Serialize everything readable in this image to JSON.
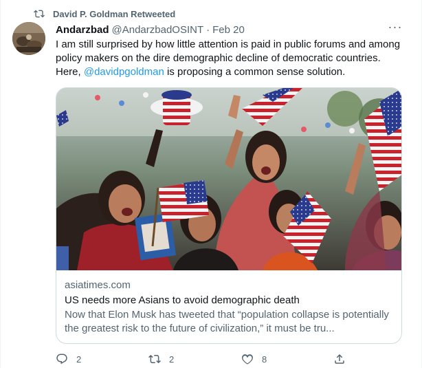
{
  "retweet": {
    "label": "David P. Goldman Retweeted"
  },
  "author": {
    "name": "Andarzbad",
    "handle": "@AndarzbadOSINT",
    "separator": "·",
    "date": "Feb 20"
  },
  "more_label": "···",
  "tweet": {
    "text_before": "I am still surprised by how little attention is paid in public forums and among policy makers on the dire demographic decline of democratic countries.",
    "text_here": "Here,",
    "mention": "@davidpgoldman",
    "text_after": "is proposing a common sense solution."
  },
  "card": {
    "domain": "asiatimes.com",
    "title": "US needs more Asians to avoid demographic death",
    "description": "Now that Elon Musk has tweeted that “population collapse is potentially the greatest risk to the future of civilization,” it must be tru..."
  },
  "actions": {
    "reply_count": "2",
    "retweet_count": "2",
    "like_count": "8"
  },
  "colors": {
    "link": "#1d9bf0",
    "secondary": "#536471",
    "border": "#cfd9de"
  }
}
